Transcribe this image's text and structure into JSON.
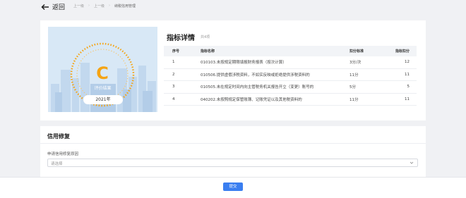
{
  "header": {
    "back_label": "返回",
    "breadcrumbs": [
      "上一级",
      "上一级",
      "纳税信用管理"
    ]
  },
  "evaluation": {
    "grade": "C",
    "label": "评价结果",
    "year": "2021年"
  },
  "detail": {
    "title": "指标详情",
    "count": "共4项",
    "columns": [
      "序号",
      "指标名称",
      "扣分标准",
      "指标扣分"
    ],
    "rows": [
      {
        "index": "1",
        "name": "010103.未按规定期限填报财务报表（按次计算）",
        "standard": "3分/次",
        "deduction": "12"
      },
      {
        "index": "2",
        "name": "010506.提供虚假涉税资料，不如实反映或拒绝提供涉税资料的",
        "standard": "11分",
        "deduction": "11"
      },
      {
        "index": "3",
        "name": "010505.未在规定时间内向主管税务机关报告开立（变更）账号的",
        "standard": "5分",
        "deduction": "5"
      },
      {
        "index": "4",
        "name": "040202.未按照规定保管账簿、记账凭证以及其他税资料的",
        "standard": "11分",
        "deduction": "11"
      }
    ]
  },
  "repair": {
    "title": "信用修复",
    "field_label": "申请信用修复原因",
    "placeholder": "请选择"
  },
  "footer": {
    "submit_label": "提交"
  },
  "colors": {
    "accent": "#3a7ef0",
    "grade": "#f5a414",
    "gauge": "#f5a414",
    "panel_bg": "#d8e8f6"
  },
  "icons": {
    "back": "arrow-left-icon",
    "select": "chevron-down-icon"
  }
}
